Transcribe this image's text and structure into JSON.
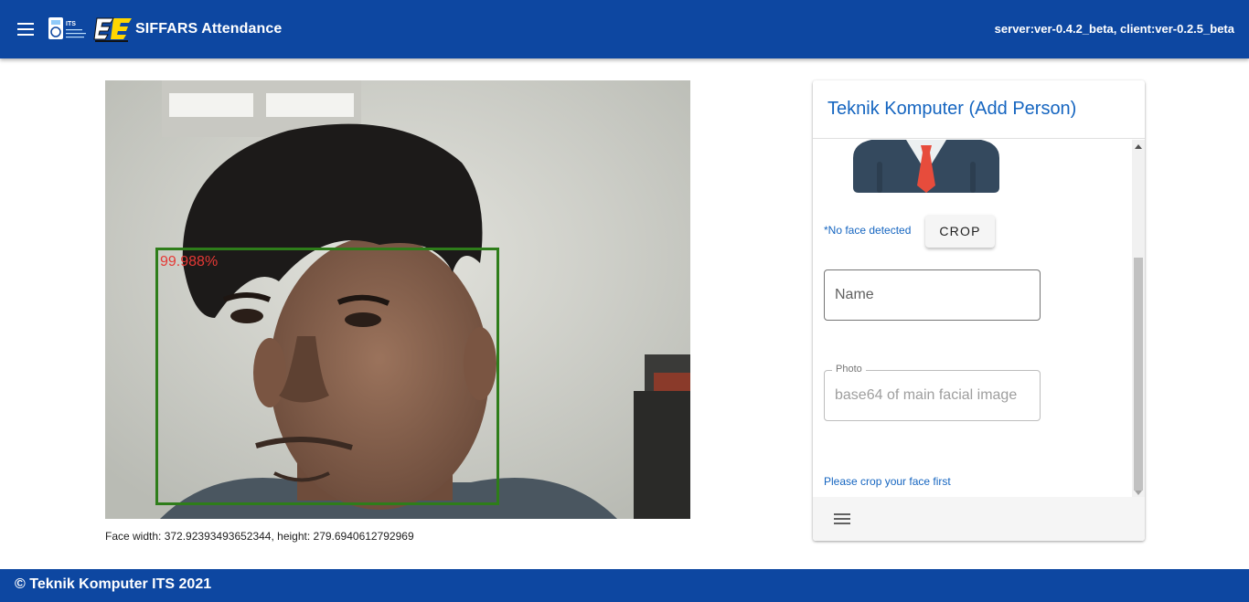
{
  "app_bar": {
    "menu_icon": "hamburger-menu-icon",
    "title": "SIFFARS Attendance",
    "logo_its_text": "ITS",
    "version": "server:ver-0.4.2_beta, client:ver-0.2.5_beta",
    "color": "#0d47a1"
  },
  "camera": {
    "confidence": "99.988%",
    "face_box_color": "#2e7d1a",
    "confidence_color": "#e53935",
    "face_dimensions": "Face width: 372.92393493652344, height: 279.6940612792969"
  },
  "card": {
    "title": "Teknik Komputer (Add Person)",
    "no_face_text": "*No face detected",
    "crop_label": "CROP",
    "name_placeholder": "Name",
    "photo_legend": "Photo",
    "photo_placeholder": "base64 of main facial image",
    "crop_hint": "Please crop your face first",
    "footer_icon": "hamburger-menu-icon"
  },
  "footer": {
    "text": "© Teknik Komputer ITS 2021"
  }
}
